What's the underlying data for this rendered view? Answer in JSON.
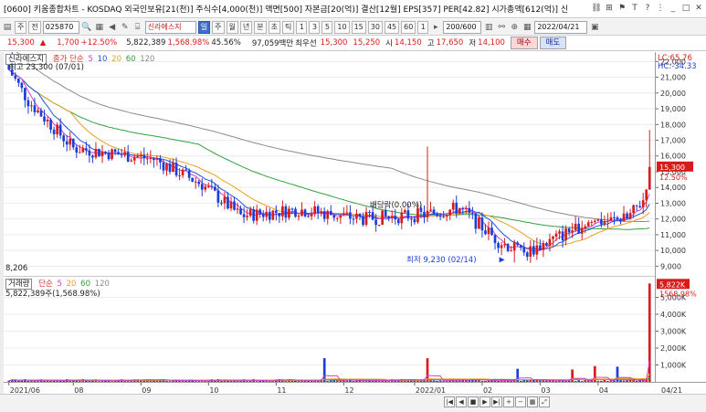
{
  "window": {
    "title": "[0600] 키움종합차트 - KOSDAQ 외국인보유[21(천)] 주식수[4,000(천)] 액면[500] 자본금[20(억)] 결산[12월] EPS[357] PER[42.82] 시가총액[612(억)] 신"
  },
  "toolbar": {
    "left_buttons": [
      "주",
      "전"
    ],
    "code": "025870",
    "name": "신라에스지",
    "periods": [
      "일",
      "주",
      "월",
      "년",
      "분",
      "초",
      "틱"
    ],
    "active_period": "일",
    "intervals": [
      "1",
      "3",
      "5",
      "10",
      "15",
      "30",
      "45",
      "60"
    ],
    "count_value": "200/600",
    "date_value": "2022/04/21"
  },
  "pricebar": {
    "price": "15,300",
    "arrow": "▲",
    "change": "1,700",
    "change_rate": "+12.50%",
    "volume": "5,822,389",
    "volume_rate": "1,568.98%",
    "turnover_rate": "45.56%",
    "amount": "97,059백만",
    "best_bid_label": "최우선",
    "best_bid_ask": "15,300",
    "best_bid_bid": "15,250",
    "open_label": "시",
    "open": "14,150",
    "high_label": "고",
    "high": "17,650",
    "low_label": "저",
    "low": "14,100",
    "buy_label": "매수",
    "sell_label": "매도"
  },
  "main_legend": {
    "box_label": "신라에스지",
    "ma_label": "종가 단순",
    "ma_periods": [
      "5",
      "10",
      "20",
      "60",
      "120"
    ],
    "high_note": "최고 23,300 (07/01)",
    "low_note": "최저 9,230 (02/14)",
    "dividend_note": "배당락(0.00%)",
    "left_bottom_value": "8,206"
  },
  "vol_legend": {
    "box_label": "거래량",
    "ma_label": "단순",
    "ma_periods": [
      "5",
      "20",
      "60",
      "120"
    ],
    "value_line": "5,822,389주(1,568.98%)"
  },
  "right_axis": {
    "lc": "LC:65.76",
    "hc": "HC:-34.33",
    "price_ticks": [
      "22,000",
      "21,000",
      "20,000",
      "19,000",
      "18,000",
      "17,000",
      "16,000",
      "15,000",
      "14,000",
      "13,000",
      "12,000",
      "11,000",
      "10,000",
      "9,000"
    ],
    "current_price": "15,300",
    "current_rate": "12.50%",
    "volume_ticks": [
      "5,000K",
      "4,000K",
      "3,000K",
      "2,000K",
      "1,000K"
    ],
    "current_volume": "5,822K",
    "current_volume_rate": "1568.98%"
  },
  "x_axis": {
    "labels": [
      "2021/06",
      "08",
      "09",
      "10",
      "11",
      "12",
      "2022/01",
      "02",
      "03",
      "04"
    ],
    "right_label": "04/21"
  },
  "colors": {
    "up": "#d81c1c",
    "down": "#1c3ed8",
    "ma5": "#d040d0",
    "ma10": "#2050e0",
    "ma20": "#e8a020",
    "ma60": "#30a040",
    "ma120": "#8a8a8a"
  },
  "chart_data": {
    "type": "candlestick",
    "price_ylim": [
      8500,
      22600
    ],
    "volume_ylim": [
      0,
      6000000
    ],
    "sample_points": [
      {
        "date": "2021/07/01",
        "high": 23300
      },
      {
        "date": "2022/02/14",
        "low": 9230
      },
      {
        "date": "2022/04/21",
        "open": 14150,
        "high": 17650,
        "low": 14100,
        "close": 15300,
        "volume": 5822389
      }
    ]
  }
}
